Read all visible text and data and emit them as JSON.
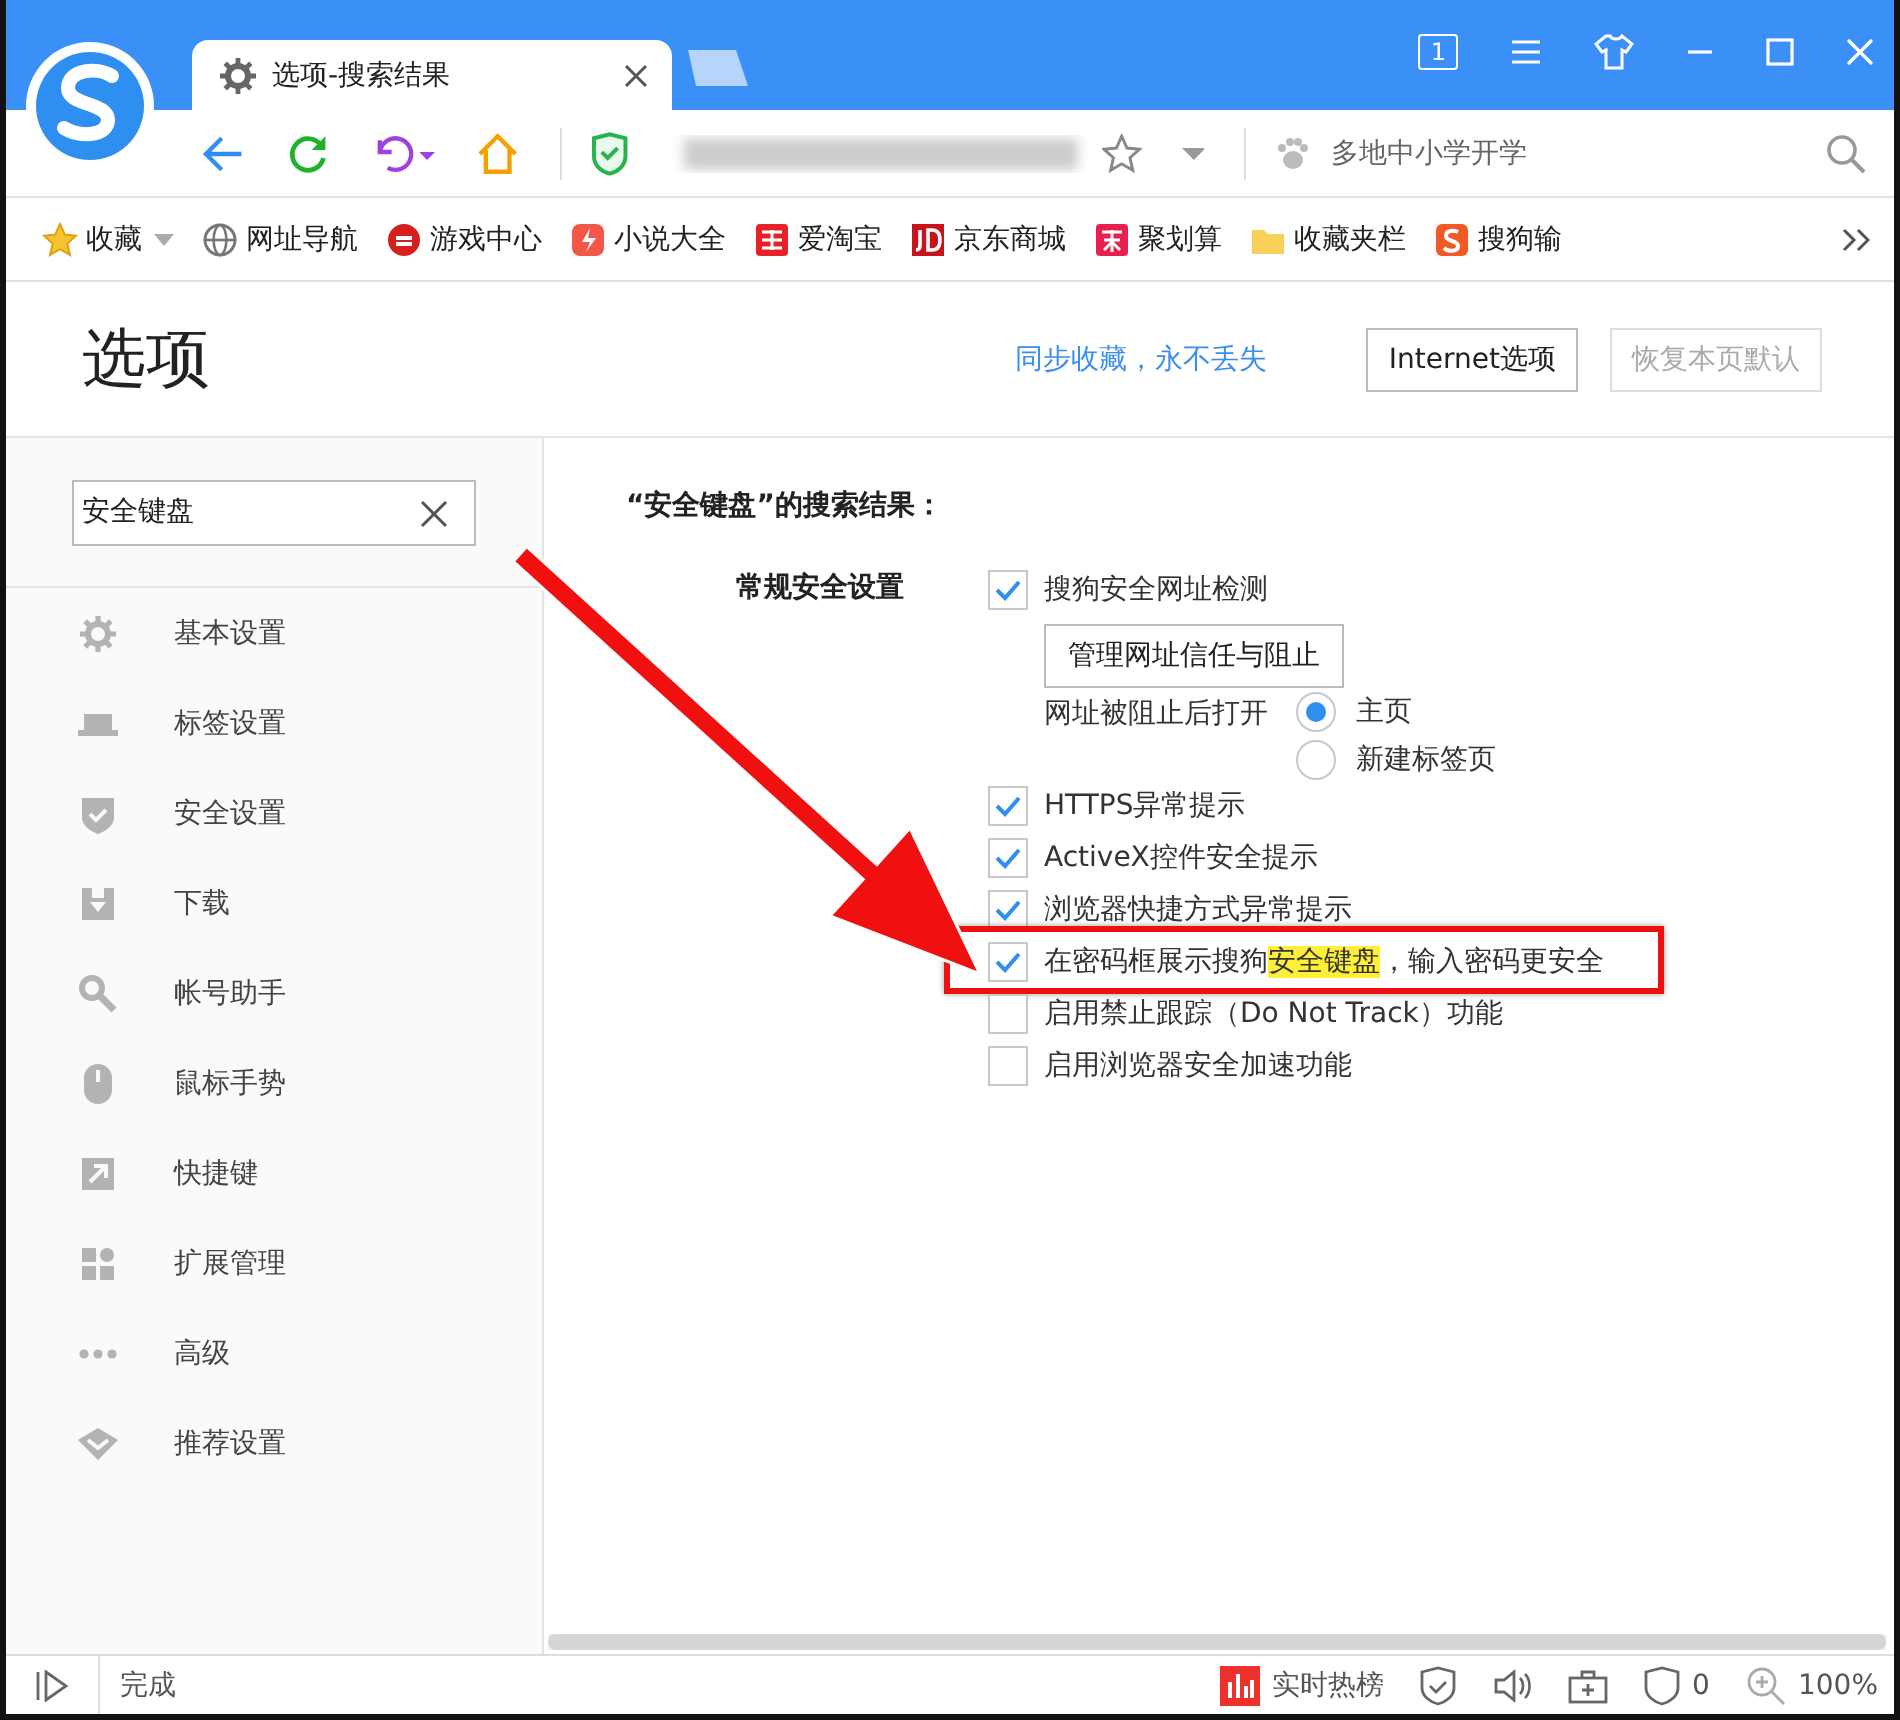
{
  "window": {
    "tab_title": "选项-搜索结果",
    "tab_count": "1"
  },
  "toolbar": {
    "search_placeholder": "多地中小学开学"
  },
  "bookmarks": [
    {
      "label": "收藏"
    },
    {
      "label": "网址导航"
    },
    {
      "label": "游戏中心"
    },
    {
      "label": "小说大全"
    },
    {
      "label": "爱淘宝"
    },
    {
      "label": "京东商城"
    },
    {
      "label": "聚划算"
    },
    {
      "label": "收藏夹栏"
    },
    {
      "label": "搜狗输"
    }
  ],
  "header": {
    "title": "选项",
    "sync_link": "同步收藏，永不丢失",
    "buttons": [
      {
        "label": "Internet选项",
        "disabled": false
      },
      {
        "label": "恢复本页默认",
        "disabled": true
      }
    ]
  },
  "sidebar": {
    "search_value": "安全键盘",
    "items": [
      {
        "label": "基本设置"
      },
      {
        "label": "标签设置"
      },
      {
        "label": "安全设置"
      },
      {
        "label": "下载"
      },
      {
        "label": "帐号助手"
      },
      {
        "label": "鼠标手势"
      },
      {
        "label": "快捷键"
      },
      {
        "label": "扩展管理"
      },
      {
        "label": "高级"
      },
      {
        "label": "推荐设置"
      }
    ]
  },
  "results": {
    "heading": "“安全键盘”的搜索结果：",
    "section": "常规安全设置",
    "items": [
      {
        "kind": "checkbox",
        "label": "搜狗安全网址检测",
        "checked": true
      },
      {
        "kind": "button",
        "label": "管理网址信任与阻止"
      },
      {
        "kind": "radio",
        "label": "网址被阻止后打开",
        "options": [
          {
            "label": "主页",
            "selected": true
          },
          {
            "label": "新建标签页",
            "selected": false
          }
        ]
      },
      {
        "kind": "checkbox",
        "label": "HTTPS异常提示",
        "checked": true
      },
      {
        "kind": "checkbox",
        "label": "ActiveX控件安全提示",
        "checked": true
      },
      {
        "kind": "checkbox",
        "label": "浏览器快捷方式异常提示",
        "checked": true
      },
      {
        "kind": "checkbox",
        "parts": [
          {
            "text": "在密码框展示搜狗",
            "highlight": false
          },
          {
            "text": "安全键盘",
            "highlight": true
          },
          {
            "text": "，输入密码更安全",
            "highlight": false
          }
        ],
        "checked": true,
        "boxed": true
      },
      {
        "kind": "checkbox",
        "label": "启用禁止跟踪（Do Not Track）功能",
        "checked": false
      },
      {
        "kind": "checkbox",
        "label": "启用浏览器安全加速功能",
        "checked": false
      }
    ]
  },
  "status_bar": {
    "status": "完成",
    "hot_list": "实时热榜",
    "ad_count": "0",
    "zoom": "100%"
  }
}
